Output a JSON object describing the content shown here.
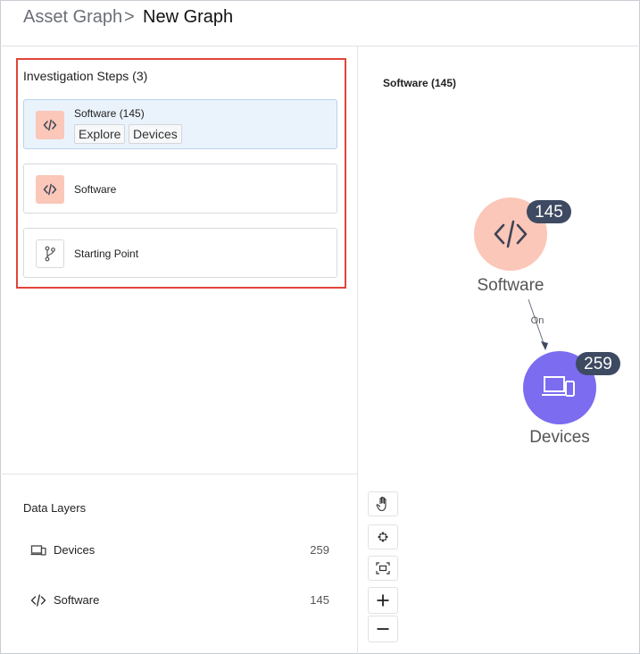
{
  "breadcrumb": {
    "parent": "Asset Graph",
    "separator": ">",
    "current": "New Graph"
  },
  "investigation": {
    "title": "Investigation Steps (3)",
    "steps": [
      {
        "label": "Software (145)",
        "icon": "code-icon",
        "active": true,
        "actions": [
          "Explore",
          "Devices"
        ]
      },
      {
        "label": "Software",
        "icon": "code-icon",
        "active": false
      },
      {
        "label": "Starting Point",
        "icon": "branch-icon",
        "active": false
      }
    ]
  },
  "data_layers": {
    "title": "Data Layers",
    "items": [
      {
        "name": "Devices",
        "count": "259",
        "icon": "devices-icon"
      },
      {
        "name": "Software",
        "count": "145",
        "icon": "code-icon"
      }
    ]
  },
  "graph": {
    "title": "Software (145)",
    "nodes": [
      {
        "name": "Software",
        "count": "145",
        "color": "#fbc7b8",
        "icon": "code-icon"
      },
      {
        "name": "Devices",
        "count": "259",
        "color": "#7b6cf0",
        "icon": "devices-icon"
      }
    ],
    "edge_label": "On"
  },
  "toolbar": {
    "tools": [
      "hand-icon",
      "snowflake-icon",
      "fit-screen-icon",
      "zoom-in-icon",
      "zoom-out-icon"
    ]
  },
  "colors": {
    "highlight_border": "#e0453b",
    "active_step_bg": "#eaf3fc",
    "software_node": "#fbc7b8",
    "devices_node": "#7b6cf0",
    "badge": "#3e4a61"
  }
}
